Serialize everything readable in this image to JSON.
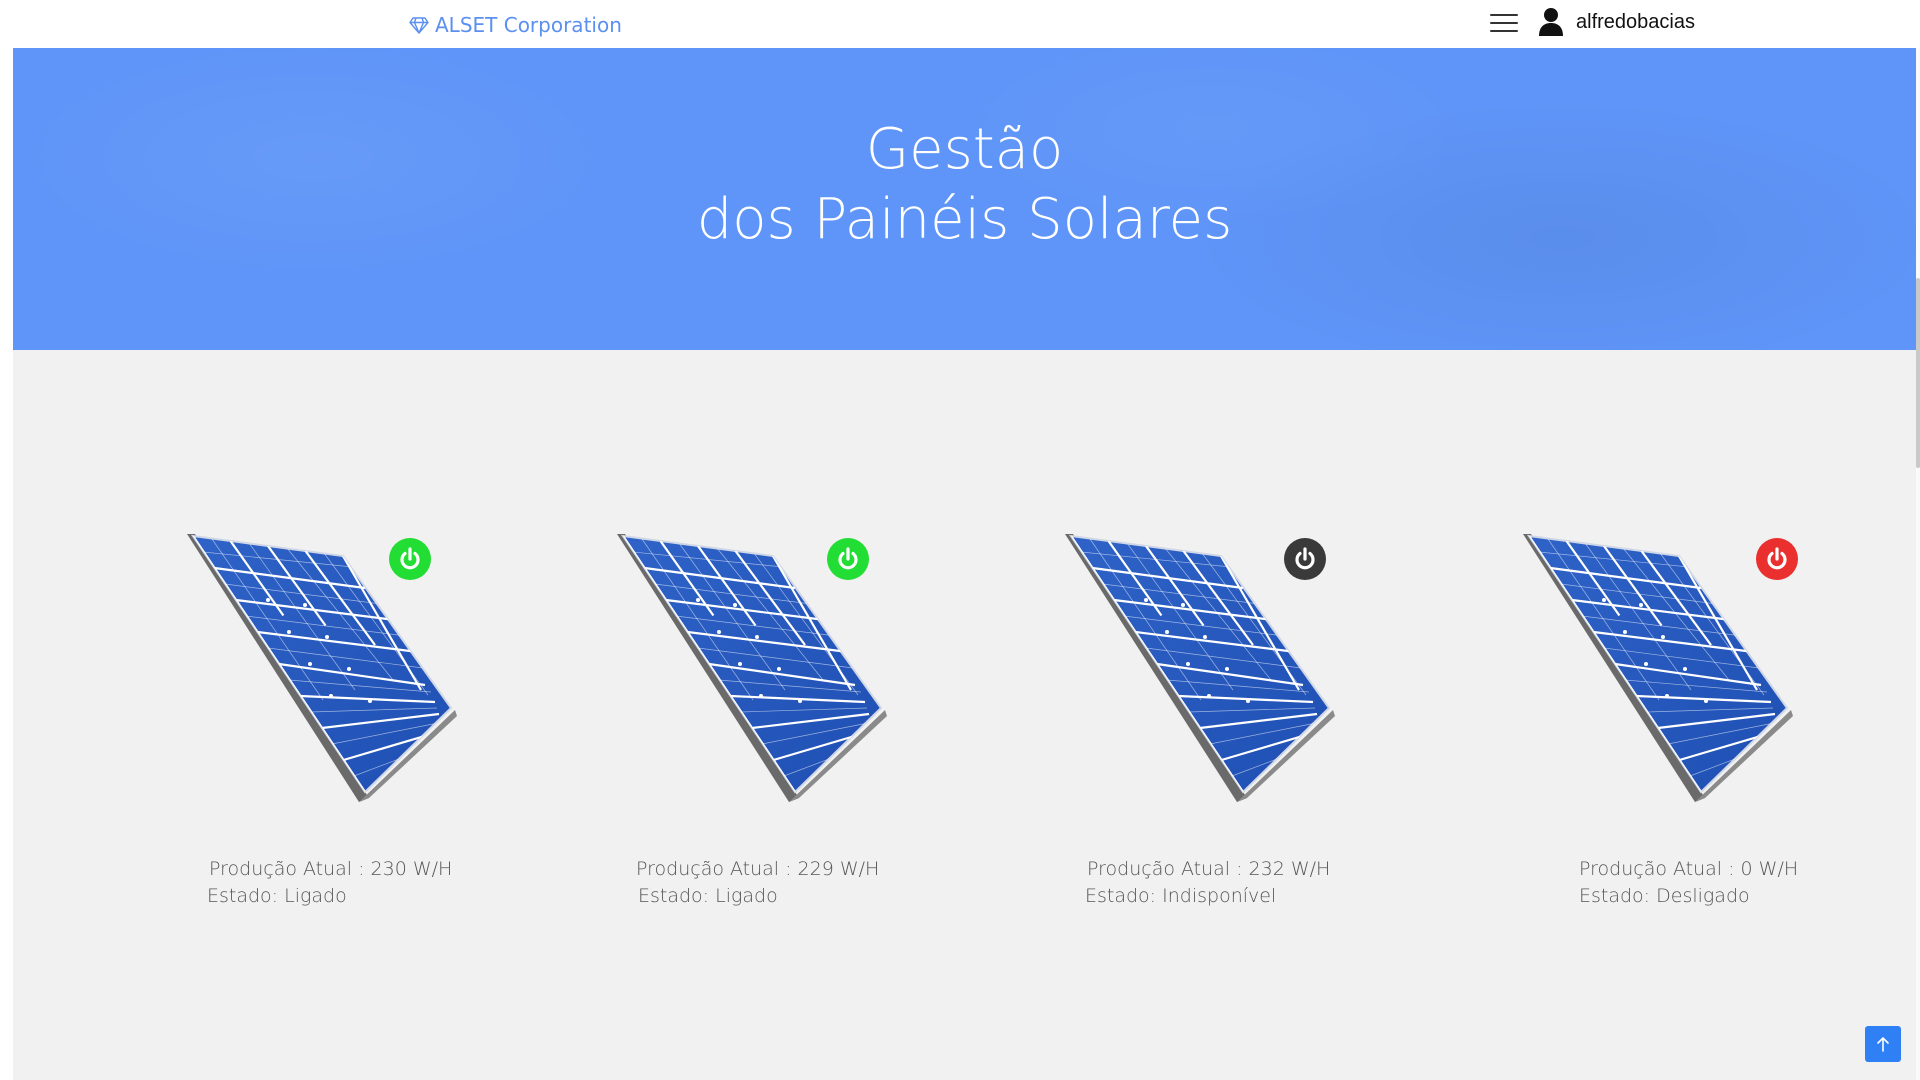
{
  "navbar": {
    "brand": "ALSET Corporation",
    "brand_icon": "gem-icon",
    "menu_icon": "hamburger-icon",
    "user_icon": "user-icon",
    "username": "alfredobacias"
  },
  "hero": {
    "title_line1": "Gestão",
    "title_line2": "dos Painéis Solares",
    "background_color": "#5f95f8"
  },
  "panels": [
    {
      "production_label": "Produção Atual : 230 W/H",
      "state_label": "Estado: Ligado",
      "status_color": "#22dd33",
      "power_icon": "power-icon"
    },
    {
      "production_label": "Produção Atual : 229 W/H",
      "state_label": "Estado: Ligado",
      "status_color": "#22dd33",
      "power_icon": "power-icon"
    },
    {
      "production_label": "Produção Atual : 232 W/H",
      "state_label": "Estado: Indisponível",
      "status_color": "#3a3a3a",
      "power_icon": "power-icon"
    },
    {
      "production_label": "Produção Atual : 0 W/H",
      "state_label": "Estado: Desligado",
      "status_color": "#ea2f2f",
      "power_icon": "power-icon"
    }
  ],
  "scroll_top_icon": "arrow-up-icon"
}
